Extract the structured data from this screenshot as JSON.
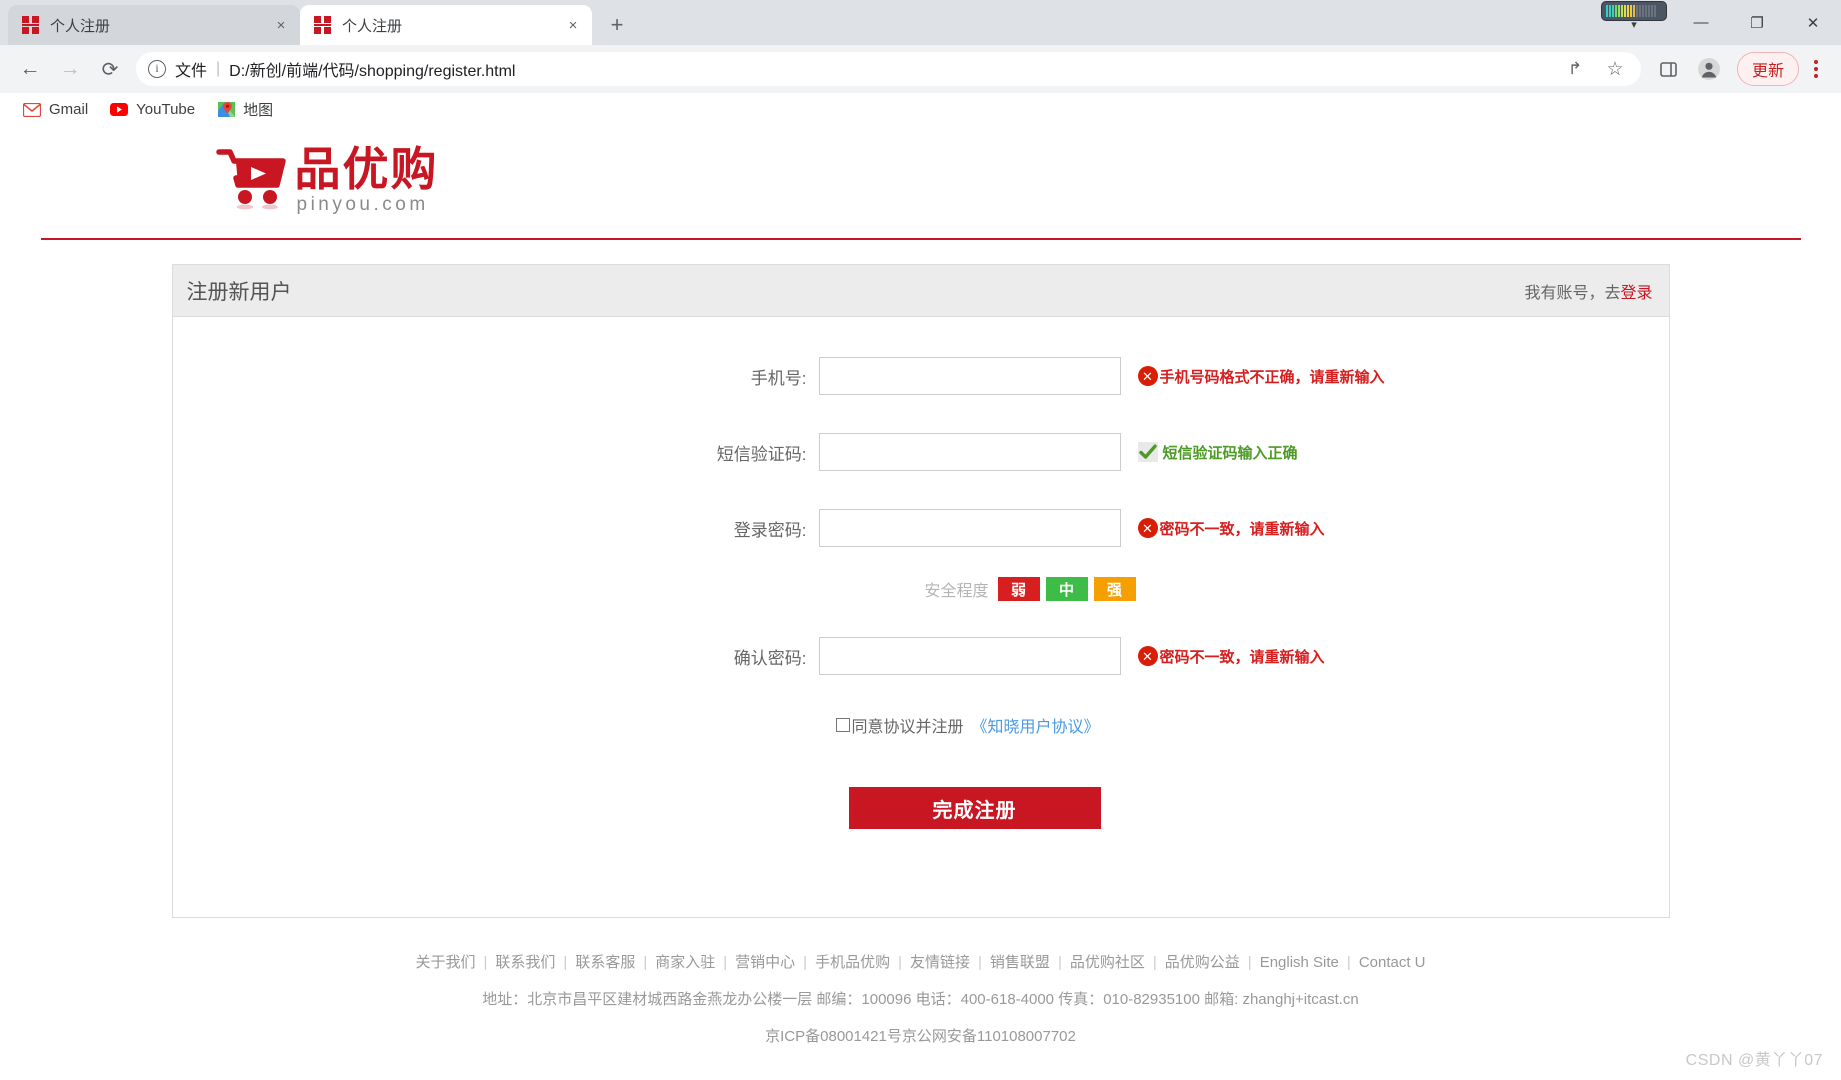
{
  "browser": {
    "tabs": [
      {
        "title": "个人注册",
        "favicon": "pinyougou-icon",
        "active": false,
        "close_label": "×"
      },
      {
        "title": "个人注册",
        "favicon": "pinyougou-icon",
        "active": true,
        "close_label": "×"
      }
    ],
    "new_tab_label": "+",
    "window_controls": {
      "minimize": "—",
      "maximize": "❐",
      "close": "✕"
    },
    "nav": {
      "back": "←",
      "forward": "→",
      "reload": "⟳"
    },
    "omnibox": {
      "info_icon": "info-circle-icon",
      "scheme_label": "文件",
      "separator": "|",
      "url": "D:/新创/前端/代码/shopping/register.html",
      "share_icon": "↱",
      "bookmark_icon": "☆",
      "sidepanel_icon": "▧",
      "profile_icon": "●"
    },
    "update_button": "更新",
    "menu_icon": "kebab-menu-icon",
    "bookmarks": [
      {
        "label": "Gmail",
        "icon": "gmail-icon"
      },
      {
        "label": "YouTube",
        "icon": "youtube-icon"
      },
      {
        "label": "地图",
        "icon": "google-maps-icon"
      }
    ]
  },
  "site": {
    "logo": {
      "cn": "品优购",
      "en": "pinyou.com",
      "icon": "shopping-cart-icon",
      "color": "#c81623"
    }
  },
  "panel": {
    "title": "注册新用户",
    "account_prompt": "我有账号，去",
    "login_link": "登录"
  },
  "form": {
    "fields": [
      {
        "label": "手机号:",
        "value": "",
        "placeholder": "",
        "tip": {
          "text": "手机号码格式不正确，请重新输入",
          "state": "error",
          "icon": "error-circle-icon"
        }
      },
      {
        "label": "短信验证码:",
        "value": "",
        "placeholder": "",
        "tip": {
          "text": "短信验证码输入正确",
          "state": "ok",
          "icon": "check-mark-icon"
        }
      },
      {
        "label": "登录密码:",
        "value": "",
        "placeholder": "",
        "tip": {
          "text": "密码不一致，请重新输入",
          "state": "error",
          "icon": "error-circle-icon"
        }
      },
      {
        "label": "确认密码:",
        "value": "",
        "placeholder": "",
        "tip": {
          "text": "密码不一致，请重新输入",
          "state": "error",
          "icon": "error-circle-icon"
        }
      }
    ],
    "strength": {
      "label": "安全程度",
      "levels": [
        {
          "text": "弱",
          "color": "#d71f1f"
        },
        {
          "text": "中",
          "color": "#3dbd48"
        },
        {
          "text": "强",
          "color": "#f5a000"
        }
      ]
    },
    "agreement": {
      "checked": false,
      "text": "同意协议并注册",
      "link": "《知晓用户协议》"
    },
    "submit_label": "完成注册"
  },
  "footer": {
    "links": [
      "关于我们",
      "联系我们",
      "联系客服",
      "商家入驻",
      "营销中心",
      "手机品优购",
      "友情链接",
      "销售联盟",
      "品优购社区",
      "品优购公益",
      "English Site",
      "Contact U"
    ],
    "separator": "|",
    "address": "地址：北京市昌平区建材城西路金燕龙办公楼一层 邮编：100096 电话：400-618-4000 传真：010-82935100 邮箱: zhanghj+itcast.cn",
    "icp": "京ICP备08001421号京公网安备110108007702"
  },
  "watermark": "CSDN @黄丫丫07"
}
